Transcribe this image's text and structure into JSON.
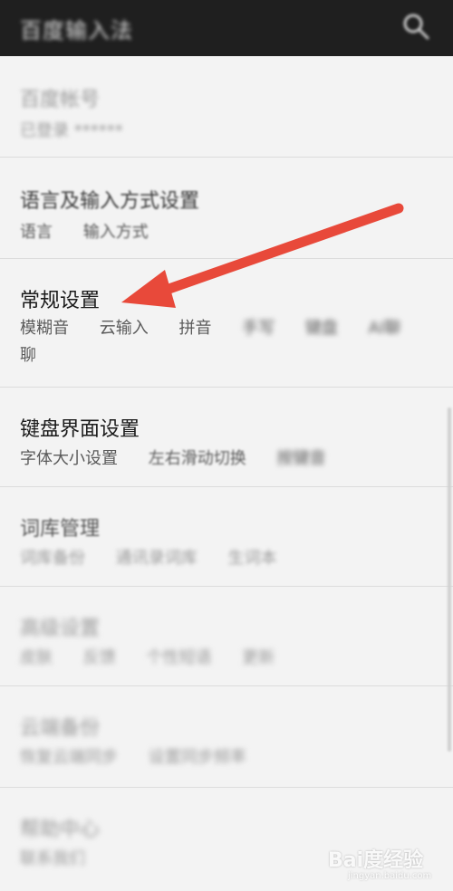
{
  "header": {
    "title": "百度输入法",
    "search_icon": "search-icon"
  },
  "items": [
    {
      "title": "百度帐号",
      "subs": [
        "已登录 ******"
      ]
    },
    {
      "title": "语言及输入方式设置",
      "subs": [
        "语言",
        "输入方式"
      ]
    },
    {
      "title": "常规设置",
      "subs": [
        "模糊音",
        "云输入",
        "拼音",
        "手写",
        "键盘",
        "AI聊",
        "聊"
      ]
    },
    {
      "title": "键盘界面设置",
      "subs": [
        "字体大小设置",
        "左右滑动切换",
        "按键音"
      ]
    },
    {
      "title": "词库管理",
      "subs": [
        "词库备份",
        "通讯录词库",
        "生词本"
      ]
    },
    {
      "title": "高级设置",
      "subs": [
        "皮肤",
        "反馈",
        "个性短语",
        "更新"
      ]
    },
    {
      "title": "云端备份",
      "subs": [
        "恢复云端同步",
        "设置同步频率"
      ]
    },
    {
      "title": "帮助中心",
      "subs": [
        "联系我们"
      ]
    }
  ],
  "watermark": {
    "text": "Bai度经验",
    "url": "jingyan.baidu.com"
  },
  "colors": {
    "topbar": "#1f1f1f",
    "background": "#f3f3f3",
    "arrow": "#e8493a"
  }
}
